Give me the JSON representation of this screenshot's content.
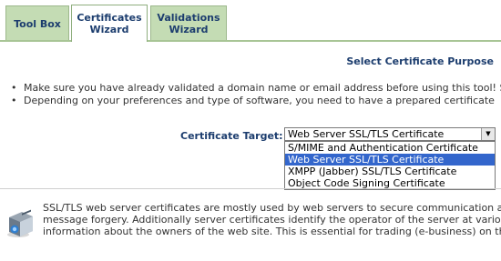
{
  "tabs": [
    {
      "label_line1": "Tool Box",
      "label_line2": ""
    },
    {
      "label_line1": "Certificates",
      "label_line2": "Wizard"
    },
    {
      "label_line1": "Validations",
      "label_line2": "Wizard"
    }
  ],
  "section_title": "Select Certificate Purpose",
  "bullets": [
    "Make sure you have already validated a domain name or email address before using this tool! S",
    "Depending on your preferences and type of software, you need to have a prepared certificate"
  ],
  "target": {
    "label": "Certificate Target:",
    "selected_value": "Web Server SSL/TLS Certificate",
    "options": [
      "S/MIME and Authentication Certificate",
      "Web Server SSL/TLS Certificate",
      "XMPP (Jabber) SSL/TLS Certificate",
      "Object Code Signing Certificate"
    ],
    "highlighted_index": 1
  },
  "description": {
    "line1": "SSL/TLS web server certificates are mostly used by web servers to secure communication a",
    "line2": "message forgery. Additionally server certificates identify the operator of the server at variou",
    "line3": "information about the owners of the web site. This is essential for trading (e-business) on th"
  },
  "icons": {
    "select_arrow": "chevron-down-icon",
    "server": "server-icon"
  },
  "colors": {
    "tab_bg": "#c4dcb4",
    "tab_text": "#1c3d6e",
    "highlight": "#3366cc"
  }
}
